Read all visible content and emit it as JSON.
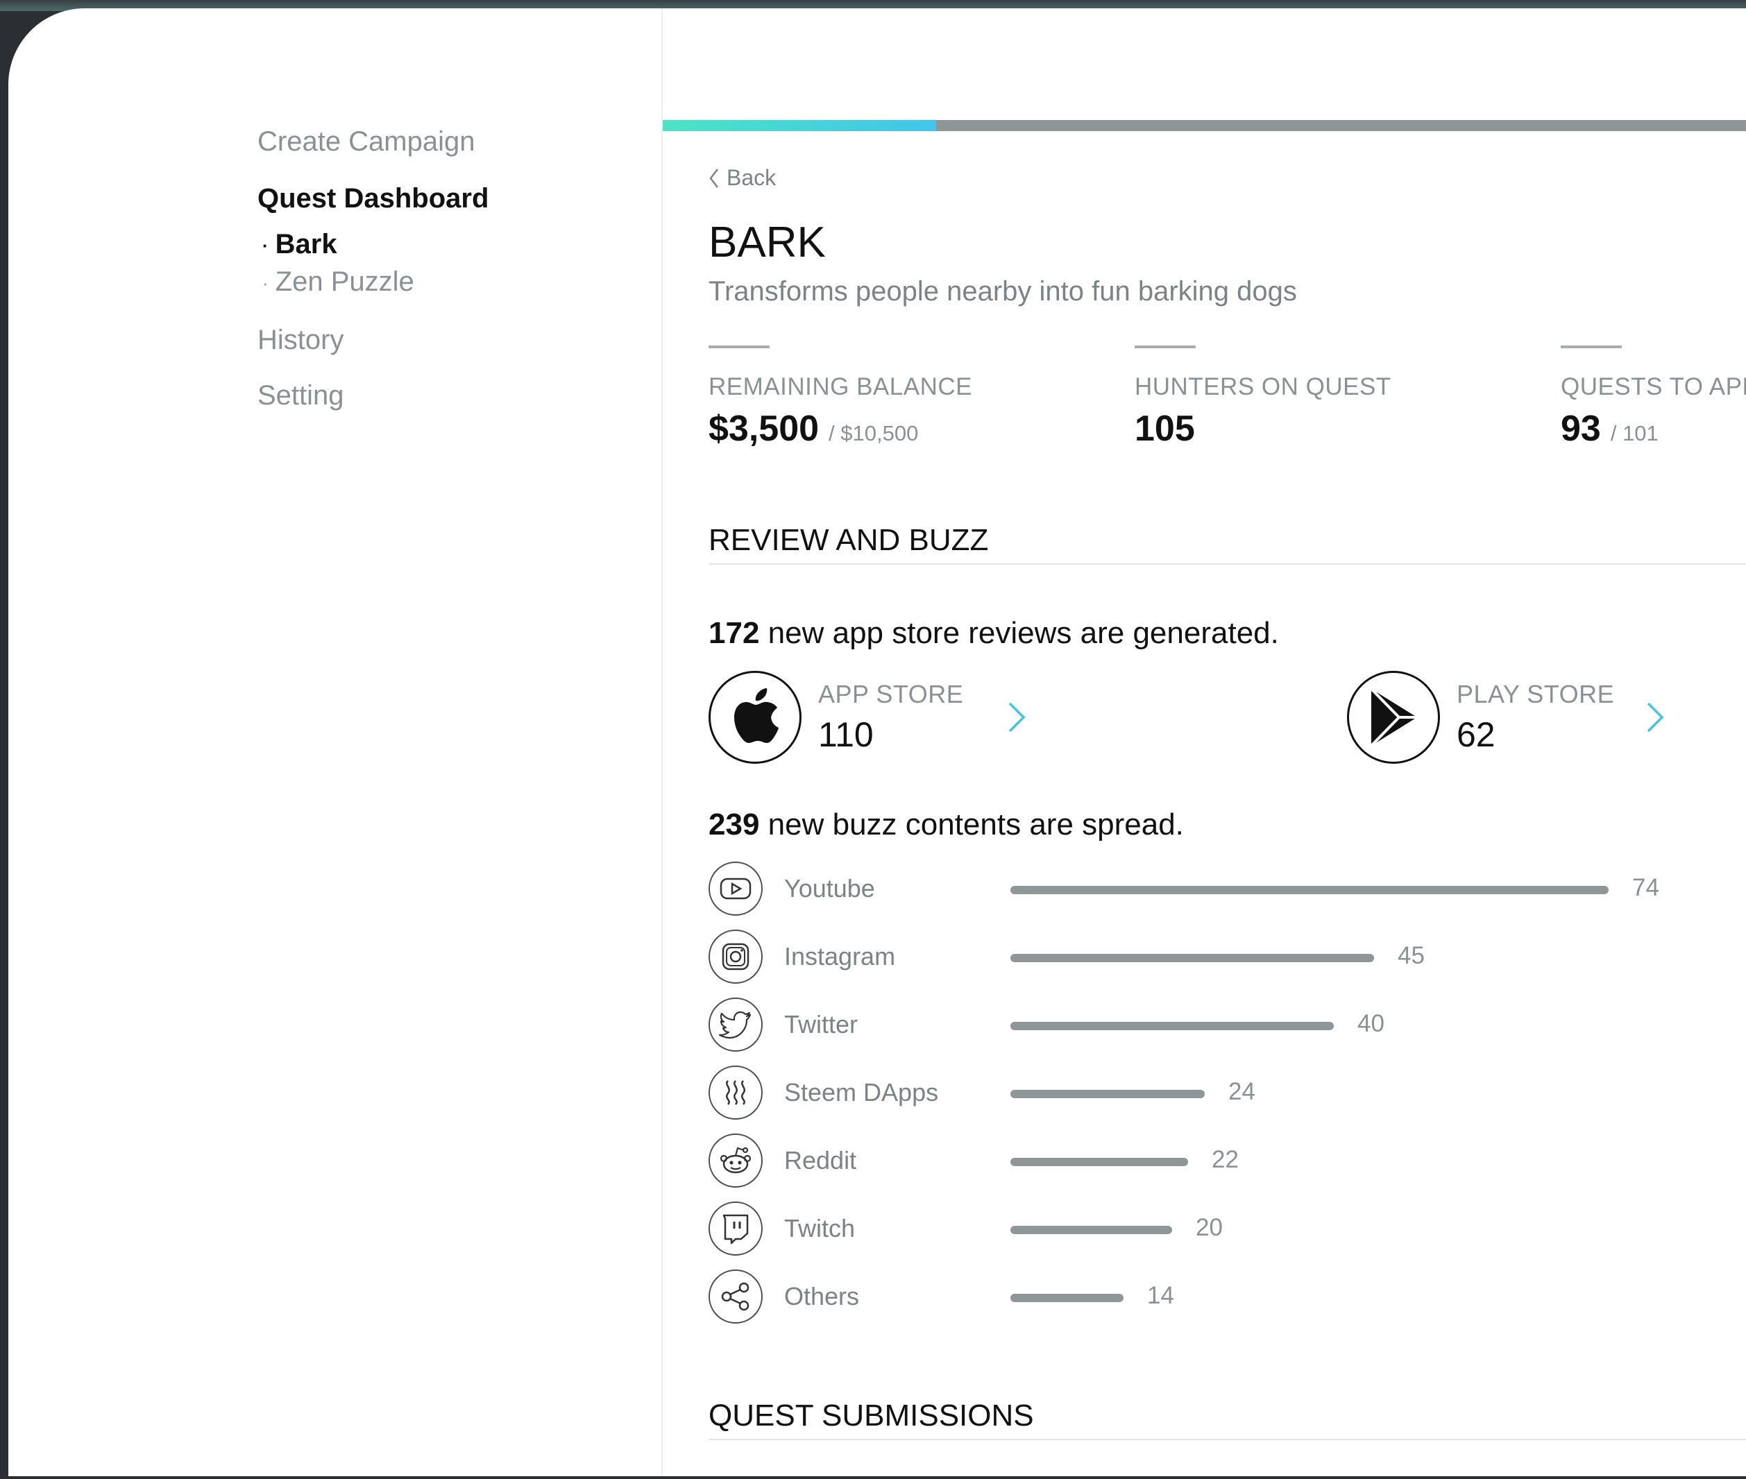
{
  "sidebar": {
    "create_campaign": "Create Campaign",
    "quest_dashboard": "Quest Dashboard",
    "quests": [
      {
        "bullet": "·",
        "label": "Bark"
      },
      {
        "bullet": "·",
        "label": "Zen Puzzle"
      }
    ],
    "history": "History",
    "setting": "Setting"
  },
  "main": {
    "progress_fraction": 0.25,
    "back_label": "Back",
    "title": "BARK",
    "subtitle": "Transforms people nearby into fun barking dogs",
    "stats": [
      {
        "label": "REMAINING BALANCE",
        "value": "$3,500",
        "of": "/ $10,500"
      },
      {
        "label": "HUNTERS ON QUEST",
        "value": "105",
        "of": ""
      },
      {
        "label": "QUESTS TO APPI",
        "value": "93",
        "of": "/ 101"
      }
    ],
    "review_section": "REVIEW AND BUZZ",
    "reviews_count": "172",
    "reviews_text": "new app store reviews are generated.",
    "stores": [
      {
        "label": "APP STORE",
        "count": "110",
        "icon": "apple-icon"
      },
      {
        "label": "PLAY STORE",
        "count": "62",
        "icon": "play-store-icon"
      }
    ],
    "buzz_count": "239",
    "buzz_text": "new buzz contents are spread.",
    "buzz": [
      {
        "name": "Youtube",
        "value": 74,
        "icon": "youtube-icon"
      },
      {
        "name": "Instagram",
        "value": 45,
        "icon": "instagram-icon"
      },
      {
        "name": "Twitter",
        "value": 40,
        "icon": "twitter-icon"
      },
      {
        "name": "Steem DApps",
        "value": 24,
        "icon": "steem-icon"
      },
      {
        "name": "Reddit",
        "value": 22,
        "icon": "reddit-icon"
      },
      {
        "name": "Twitch",
        "value": 20,
        "icon": "twitch-icon"
      },
      {
        "name": "Others",
        "value": 14,
        "icon": "share-icon"
      }
    ],
    "submissions_section": "QUEST SUBMISSIONS"
  },
  "colors": {
    "accent_start": "#4de3c4",
    "accent_end": "#3fc6ea",
    "chevron": "#3fc6ea",
    "bar": "#8e9698"
  }
}
